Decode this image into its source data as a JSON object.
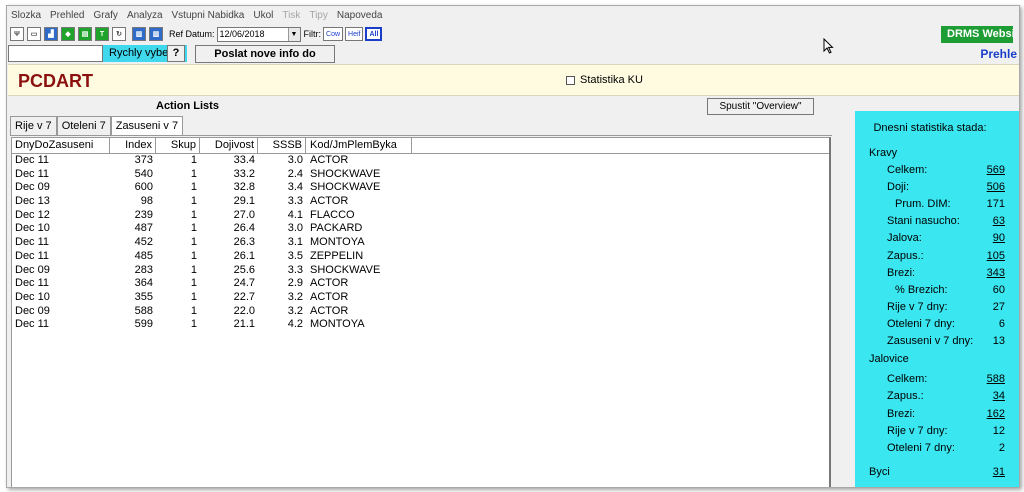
{
  "menu": [
    "Slozka",
    "Prehled",
    "Grafy",
    "Analyza",
    "Vstupni Nabidka",
    "Ukol",
    "Tisk",
    "Tipy",
    "Napoveda"
  ],
  "menu_disabled": [
    "Tisk",
    "Tipy"
  ],
  "toolbar": {
    "icons": [
      "pitchfork-icon",
      "book-icon",
      "chart-icon",
      "shield-icon",
      "sort-green-icon",
      "text-green-icon",
      "sync-icon",
      "chart-green-icon-1",
      "chart-green-icon-2"
    ],
    "ref_label": "Ref Datum:",
    "ref_date": "12/06/2018",
    "filter_label": "Filtr:",
    "filters": [
      "Cow",
      "Heif",
      "All"
    ]
  },
  "quick": {
    "label": "Rychly vyber",
    "button": "?",
    "send": "Poslat nove info do dojirny"
  },
  "drms": "DRMS Websit",
  "prehled": "Prehle",
  "header": {
    "title": "PCDART",
    "stat_label": "Statistika KU"
  },
  "actions": {
    "title": "Action Lists",
    "overview": "Spustit  \"Overview\""
  },
  "tabs": [
    "Rije v 7",
    "Oteleni 7",
    "Zasuseni v 7"
  ],
  "active_tab": 2,
  "columns": [
    "DnyDoZasuseni",
    "Index",
    "Skup",
    "Dojivost",
    "SSSB",
    "Kod/JmPlemByka"
  ],
  "rows": [
    [
      "Dec 11",
      "373",
      "1",
      "33.4",
      "3.0",
      "ACTOR"
    ],
    [
      "Dec 11",
      "540",
      "1",
      "33.2",
      "2.4",
      "SHOCKWAVE"
    ],
    [
      "Dec 09",
      "600",
      "1",
      "32.8",
      "3.4",
      "SHOCKWAVE"
    ],
    [
      "Dec 13",
      "98",
      "1",
      "29.1",
      "3.3",
      "ACTOR"
    ],
    [
      "Dec 12",
      "239",
      "1",
      "27.0",
      "4.1",
      "FLACCO"
    ],
    [
      "Dec 10",
      "487",
      "1",
      "26.4",
      "3.0",
      "PACKARD"
    ],
    [
      "Dec 11",
      "452",
      "1",
      "26.3",
      "3.1",
      "MONTOYA"
    ],
    [
      "Dec 11",
      "485",
      "1",
      "26.1",
      "3.5",
      "ZEPPELIN"
    ],
    [
      "Dec 09",
      "283",
      "1",
      "25.6",
      "3.3",
      "SHOCKWAVE"
    ],
    [
      "Dec 11",
      "364",
      "1",
      "24.7",
      "2.9",
      "ACTOR"
    ],
    [
      "Dec 10",
      "355",
      "1",
      "22.7",
      "3.2",
      "ACTOR"
    ],
    [
      "Dec 09",
      "588",
      "1",
      "22.0",
      "3.2",
      "ACTOR"
    ],
    [
      "Dec 11",
      "599",
      "1",
      "21.1",
      "4.2",
      "MONTOYA"
    ]
  ],
  "stats": {
    "title": "Dnesni statistika stada:",
    "items": [
      {
        "k": "Kravy",
        "v": "",
        "indent": 0,
        "link": false
      },
      {
        "k": "Celkem:",
        "v": "569",
        "indent": 1,
        "link": true
      },
      {
        "k": "Doji:",
        "v": "506",
        "indent": 1,
        "link": true
      },
      {
        "k": "Prum. DIM:",
        "v": "171",
        "indent": 2,
        "link": false
      },
      {
        "k": "Stani nasucho:",
        "v": "63",
        "indent": 1,
        "link": true
      },
      {
        "k": "Jalova:",
        "v": "90",
        "indent": 1,
        "link": true
      },
      {
        "k": "Zapus.:",
        "v": "105",
        "indent": 1,
        "link": true
      },
      {
        "k": "Brezi:",
        "v": "343",
        "indent": 1,
        "link": true
      },
      {
        "k": "% Brezich:",
        "v": "60",
        "indent": 2,
        "link": false
      },
      {
        "k": "Rije v 7 dny:",
        "v": "27",
        "indent": 1,
        "link": false
      },
      {
        "k": "Oteleni 7 dny:",
        "v": "6",
        "indent": 1,
        "link": false
      },
      {
        "k": "Zasuseni v 7 dny:",
        "v": "13",
        "indent": 1,
        "link": false
      },
      {
        "k": "Jalovice",
        "v": "",
        "indent": 0,
        "link": false
      },
      {
        "k": "Celkem:",
        "v": "588",
        "indent": 1,
        "link": true
      },
      {
        "k": "Zapus.:",
        "v": "34",
        "indent": 1,
        "link": true
      },
      {
        "k": "Brezi:",
        "v": "162",
        "indent": 1,
        "link": true
      },
      {
        "k": "Rije v 7 dny:",
        "v": "12",
        "indent": 1,
        "link": false
      },
      {
        "k": "Oteleni 7 dny:",
        "v": "2",
        "indent": 1,
        "link": false
      },
      {
        "k": "Byci",
        "v": "31",
        "indent": 0,
        "link": true
      }
    ]
  },
  "colors": {
    "brand": "#8b1010",
    "cyan": "#3ae6f0",
    "header_bg": "#fffbe1",
    "drms_green": "#1f9d35",
    "link_blue": "#1a3ec9"
  }
}
